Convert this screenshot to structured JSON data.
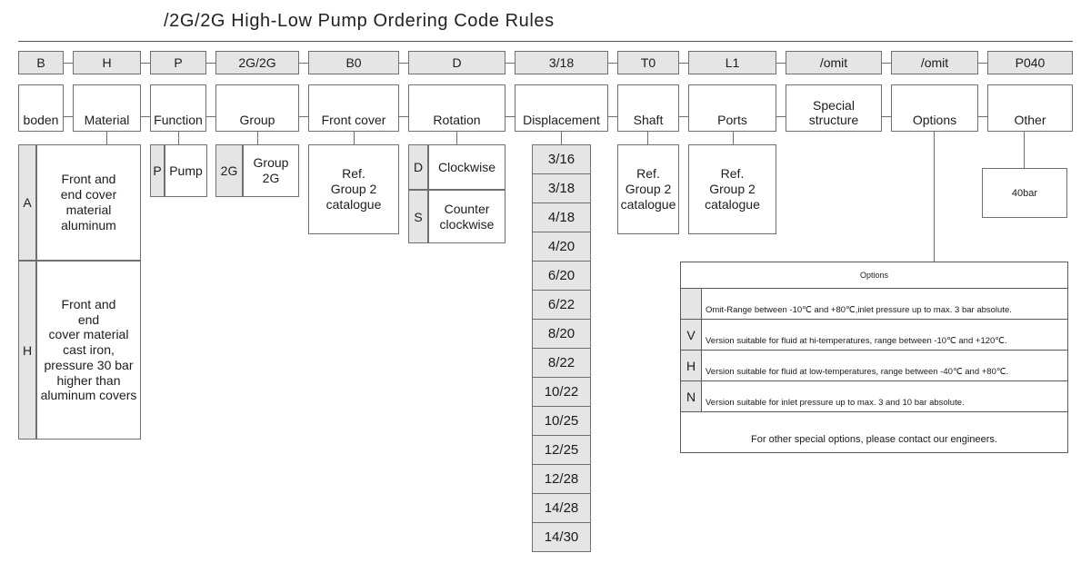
{
  "title": "/2G/2G High-Low Pump Ordering Code Rules",
  "code_row": [
    {
      "code": "B"
    },
    {
      "code": "H"
    },
    {
      "code": "P"
    },
    {
      "code": "2G/2G"
    },
    {
      "code": "B0"
    },
    {
      "code": "D"
    },
    {
      "code": "3/18"
    },
    {
      "code": "T0"
    },
    {
      "code": "L1"
    },
    {
      "code": "/omit"
    },
    {
      "code": "/omit"
    },
    {
      "code": "P040"
    }
  ],
  "label_row": [
    {
      "label": "boden"
    },
    {
      "label": "Material"
    },
    {
      "label": "Function"
    },
    {
      "label": "Group"
    },
    {
      "label": "Front cover"
    },
    {
      "label": "Rotation"
    },
    {
      "label": "Displacement"
    },
    {
      "label": "Shaft"
    },
    {
      "label": "Ports"
    },
    {
      "label": "Special structure"
    },
    {
      "label": "Options"
    },
    {
      "label": "Other"
    }
  ],
  "material": {
    "rows": [
      {
        "code": "A",
        "text": "Front and\nend cover\nmaterial\naluminum"
      },
      {
        "code": "H",
        "text": "Front and\nend\ncover material\ncast iron,\npressure 30 bar\nhigher than\naluminum covers"
      }
    ]
  },
  "function": {
    "rows": [
      {
        "code": "P",
        "text": "Pump"
      }
    ]
  },
  "group": {
    "rows": [
      {
        "code": "2G",
        "text": "Group 2G"
      }
    ]
  },
  "front_cover": {
    "text": "Ref.\nGroup 2\ncatalogue"
  },
  "rotation": {
    "rows": [
      {
        "code": "D",
        "text": "Clockwise"
      },
      {
        "code": "S",
        "text": "Counter\nclockwise"
      }
    ]
  },
  "displacement": {
    "values": [
      "3/16",
      "3/18",
      "4/18",
      "4/20",
      "6/20",
      "6/22",
      "8/20",
      "8/22",
      "10/22",
      "10/25",
      "12/25",
      "12/28",
      "14/28",
      "14/30"
    ]
  },
  "shaft": {
    "text": "Ref.\nGroup 2\ncatalogue"
  },
  "ports": {
    "text": "Ref.\nGroup 2\ncatalogue"
  },
  "other": {
    "text": "40bar"
  },
  "options": {
    "header": "Options",
    "rows": [
      {
        "code": "",
        "desc": "Omit-Range between -10℃ and +80℃,inlet pressure up to max. 3 bar absolute."
      },
      {
        "code": "V",
        "desc": "Version suitable for fluid at hi-temperatures, range between -10℃ and +120℃."
      },
      {
        "code": "H",
        "desc": "Version suitable for fluid at low-temperatures, range between -40℃ and +80℃."
      },
      {
        "code": "N",
        "desc": "Version suitable for inlet pressure up to max. 3 and 10 bar absolute."
      }
    ],
    "footer": "For other special options, please contact our engineers."
  },
  "colors": {
    "cell_grey": "#e5e5e5",
    "border": "#6f6f6f",
    "text": "#1d1d1d"
  }
}
